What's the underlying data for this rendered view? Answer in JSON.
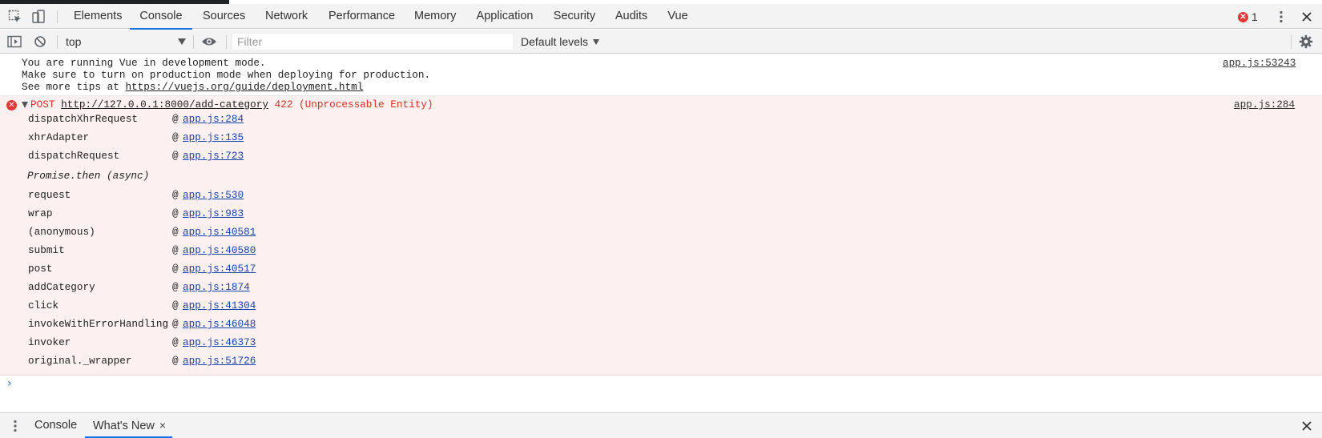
{
  "tabs": [
    "Elements",
    "Console",
    "Sources",
    "Network",
    "Performance",
    "Memory",
    "Application",
    "Security",
    "Audits",
    "Vue"
  ],
  "active_tab": "Console",
  "error_count": "1",
  "icons": {
    "inspect": "inspect-element-icon",
    "device": "device-toolbar-icon",
    "menu": "kebab-menu-icon",
    "close": "close-icon",
    "sidebar": "show-sidebar-icon",
    "clear": "clear-console-icon",
    "eye": "live-expression-eye-icon",
    "settings": "gear-icon"
  },
  "console_toolbar": {
    "context": "top",
    "filter_placeholder": "Filter",
    "levels": "Default levels"
  },
  "info_message": {
    "line1": "You are running Vue in development mode.",
    "line2": "Make sure to turn on production mode when deploying for production.",
    "line3_prefix": "See more tips at ",
    "line3_url": "https://vuejs.org/guide/deployment.html",
    "source": "app.js:53243"
  },
  "error_message": {
    "method": "POST",
    "url": "http://127.0.0.1:8000/add-category",
    "status": "422 (Unprocessable Entity)",
    "source": "app.js:284",
    "stack_group1": [
      {
        "fn": "dispatchXhrRequest",
        "loc": "app.js:284"
      },
      {
        "fn": "xhrAdapter",
        "loc": "app.js:135"
      },
      {
        "fn": "dispatchRequest",
        "loc": "app.js:723"
      }
    ],
    "async_label": "Promise.then (async)",
    "stack_group2": [
      {
        "fn": "request",
        "loc": "app.js:530"
      },
      {
        "fn": "wrap",
        "loc": "app.js:983"
      },
      {
        "fn": "(anonymous)",
        "loc": "app.js:40581"
      },
      {
        "fn": "submit",
        "loc": "app.js:40580"
      },
      {
        "fn": "post",
        "loc": "app.js:40517"
      },
      {
        "fn": "addCategory",
        "loc": "app.js:1874"
      },
      {
        "fn": "click",
        "loc": "app.js:41304"
      },
      {
        "fn": "invokeWithErrorHandling",
        "loc": "app.js:46048"
      },
      {
        "fn": "invoker",
        "loc": "app.js:46373"
      },
      {
        "fn": "original._wrapper",
        "loc": "app.js:51726"
      }
    ]
  },
  "prompt_symbol": "›",
  "drawer": {
    "tabs": [
      "Console",
      "What's New"
    ],
    "active": "What's New",
    "close_glyph": "×"
  },
  "colors": {
    "accent": "#1a73e8",
    "error_text": "#d93025",
    "error_bg": "#fcf0f0",
    "link": "#1a44a8"
  }
}
